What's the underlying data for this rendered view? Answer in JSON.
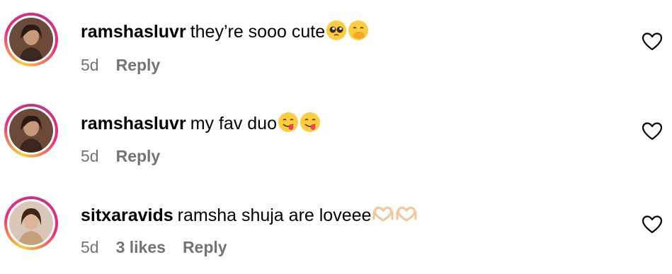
{
  "comments": [
    {
      "username": "ramshasluvr",
      "text": "they’re sooo cute",
      "emojis": [
        "pleading-face",
        "hand-over-mouth-face"
      ],
      "time": "5d",
      "likes": "",
      "reply_label": "Reply"
    },
    {
      "username": "ramshasluvr",
      "text": "my fav duo",
      "emojis": [
        "savoring-food-face",
        "savoring-food-face"
      ],
      "time": "5d",
      "likes": "",
      "reply_label": "Reply"
    },
    {
      "username": "sitxaravids",
      "text": "ramsha shuja are loveee",
      "emojis": [
        "heart-hands",
        "heart-hands"
      ],
      "time": "5d",
      "likes": "3 likes",
      "reply_label": "Reply"
    }
  ],
  "colors": {
    "text": "#000000",
    "meta": "#737373",
    "story_ring": "#ee2a7b"
  },
  "icons": [
    "heart-outline-icon"
  ]
}
